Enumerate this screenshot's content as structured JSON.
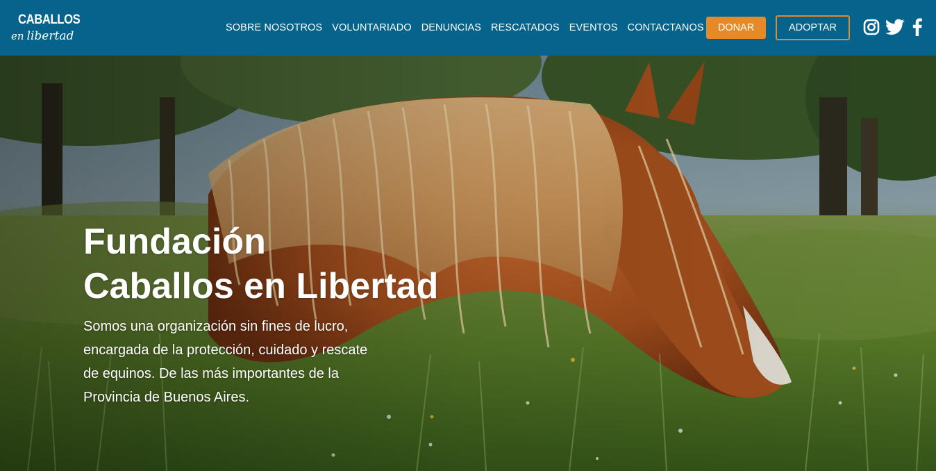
{
  "brand": {
    "logo_top": "CABALLOS",
    "logo_en": "en",
    "logo_script": "libertad"
  },
  "nav": {
    "items": [
      {
        "label": "SOBRE NOSOTROS"
      },
      {
        "label": "VOLUNTARIADO"
      },
      {
        "label": "DENUNCIAS"
      },
      {
        "label": "RESCATADOS"
      },
      {
        "label": "EVENTOS"
      },
      {
        "label": "CONTACTANOS"
      }
    ],
    "donate_label": "DONAR",
    "adopt_label": "ADOPTAR"
  },
  "social": {
    "icons": [
      "instagram-icon",
      "twitter-icon",
      "facebook-icon"
    ]
  },
  "hero": {
    "title_line1": "Fundación",
    "title_line2": "Caballos en Libertad",
    "description": "Somos una organización sin fines de lucro, encargada de la protección, cuidado y rescate de equinos. De las más importantes de la Provincia de Buenos Aires."
  },
  "colors": {
    "navbar_bg": "#05638c",
    "accent": "#e58a27",
    "text": "#ffffff"
  }
}
